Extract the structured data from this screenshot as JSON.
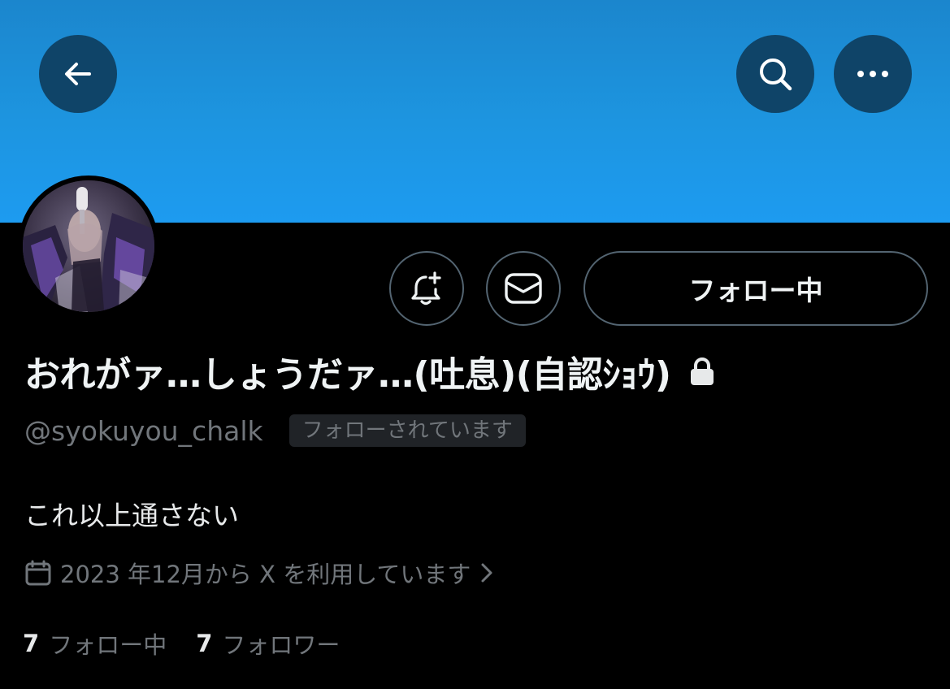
{
  "header": {
    "back_icon": "arrow-left-icon",
    "search_icon": "search-icon",
    "more_icon": "more-horizontal-icon",
    "banner_color": "#1d9bf0",
    "button_bg": "#0f4468"
  },
  "profile": {
    "display_name": "おれがァ…しょうだァ…(吐息)(自認ｼｮｳ)",
    "protected_icon": "lock-icon",
    "handle": "@syokuyou_chalk",
    "follows_you_badge": "フォローされています",
    "bio": "これ以上通さない",
    "joined_icon": "calendar-icon",
    "joined": "2023 年12月から X を利用しています",
    "joined_chevron_icon": "chevron-right-icon"
  },
  "actions": {
    "notify_icon": "bell-plus-icon",
    "message_icon": "envelope-icon",
    "following_label": "フォロー中"
  },
  "stats": {
    "following_count": "7",
    "following_label": "フォロー中",
    "followers_count": "7",
    "followers_label": "フォロワー"
  },
  "colors": {
    "background": "#000000",
    "primary_text": "#e7e9ea",
    "secondary_text": "#71767b",
    "border": "#536471"
  }
}
